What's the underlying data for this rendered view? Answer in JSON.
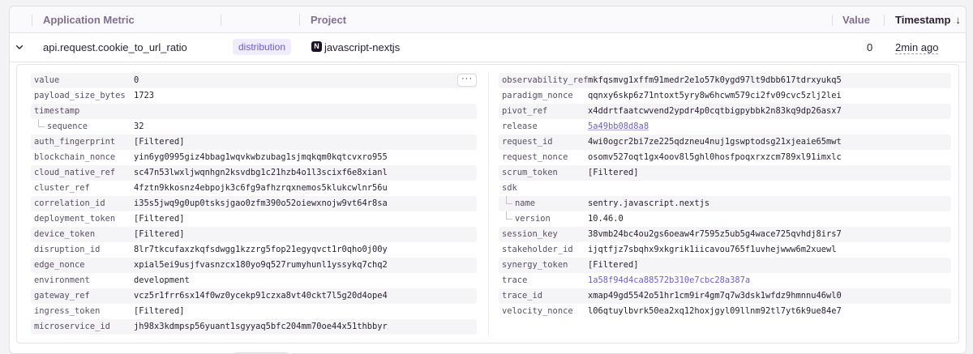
{
  "table": {
    "headers": {
      "metric": "Application Metric",
      "project": "Project",
      "value": "Value",
      "timestamp": "Timestamp"
    },
    "row": {
      "metric": "api.request.cookie_to_url_ratio",
      "type": "distribution",
      "project_icon": "N",
      "project": "javascript-nextjs",
      "value": "0",
      "timestamp": "2min ago"
    }
  },
  "details": {
    "more_label": "···",
    "left": [
      {
        "key": "value",
        "value": "0"
      },
      {
        "key": "payload_size_bytes",
        "value": "1723"
      },
      {
        "key": "timestamp",
        "value": ""
      },
      {
        "key": "sequence",
        "value": "32",
        "child": true
      },
      {
        "key": "auth_fingerprint",
        "value": "[Filtered]"
      },
      {
        "key": "blockchain_nonce",
        "value": "yin6yg0995giz4bbag1wqvkwbzubag1sjmqkqm0kqtcvxro955"
      },
      {
        "key": "cloud_native_ref",
        "value": "sc47n53lwxljwqnhgn2ksvdbg1c21hzb4o1l3scixf6e8xianl"
      },
      {
        "key": "cluster_ref",
        "value": "4fztn9kkosnz4ebpojk3c6fg9afhzrqxnemos5klukcwlnr56u"
      },
      {
        "key": "correlation_id",
        "value": "i35s5jwq9g0up0tsksjgao0zfm390o52oiewxnojw9vt64r8sa"
      },
      {
        "key": "deployment_token",
        "value": "[Filtered]"
      },
      {
        "key": "device_token",
        "value": "[Filtered]"
      },
      {
        "key": "disruption_id",
        "value": "8lr7tkcufaxzkqfsdwgg1kzzrg5fop21egyqvct1r0qho0j00y"
      },
      {
        "key": "edge_nonce",
        "value": "xpial5ei9usjfvasnzcx180yo9q527rumyhunl1yssykq7chq2"
      },
      {
        "key": "environment",
        "value": "development"
      },
      {
        "key": "gateway_ref",
        "value": "vcz5r1frr6sx14f0wz0ycekp91czxa8vt40ckt7l5g20d4ope4"
      },
      {
        "key": "ingress_token",
        "value": "[Filtered]"
      },
      {
        "key": "microservice_id",
        "value": "jh98x3kdmpsp56yuant1sgyyaq5bfc204mm70oe44x51thbbyr"
      }
    ],
    "right": [
      {
        "key": "observability_ref",
        "value": "mkfqsmvg1xffm91medr2e1o57k0ygd97lt9dbb617tdrxyukq5"
      },
      {
        "key": "paradigm_nonce",
        "value": "qqnxy6skp6z71ntoxt5yry8w6hcwm579ci2fv09cvc5zlj2lei"
      },
      {
        "key": "pivot_ref",
        "value": "x4ddrtfaatcwvend2ypdr4p0cqtbigpybbk2n83kq9dp26asx7"
      },
      {
        "key": "release",
        "value": "5a49bb08d8a8",
        "style": "link"
      },
      {
        "key": "request_id",
        "value": "4wi0ogcr2bi7ze225qdzneu4nuj1gswptodsg21xjeaie65mwt"
      },
      {
        "key": "request_nonce",
        "value": "osomv527oqt1gx4oov8l5ghl0hosfpoqxrxzcm789xl91imxlc"
      },
      {
        "key": "scrum_token",
        "value": "[Filtered]"
      },
      {
        "key": "sdk",
        "value": ""
      },
      {
        "key": "name",
        "value": "sentry.javascript.nextjs",
        "child": true
      },
      {
        "key": "version",
        "value": "10.46.0",
        "child": true
      },
      {
        "key": "session_key",
        "value": "38vmb24bc4ou2gs6oeaw4r7595z5ub5g4wace725qvhdj8irs7"
      },
      {
        "key": "stakeholder_id",
        "value": "ijqtfjz7sbqhx9xkgrik1iicavou765f1uvhejwww6m2xuewl"
      },
      {
        "key": "synergy_token",
        "value": "[Filtered]"
      },
      {
        "key": "trace",
        "value": "1a58f94d4ca88572b310e7cbc28a387a",
        "style": "plain-link"
      },
      {
        "key": "trace_id",
        "value": "xmap49gd5542o51hr1cm9ir4gm7q7w3dsk1wfdz9hmnnu46wl0"
      },
      {
        "key": "velocity_nonce",
        "value": "l06qtuylbvrk50ea2xq12hoxjgyl09llnm92tl7yt6k9ue84e7"
      }
    ]
  }
}
